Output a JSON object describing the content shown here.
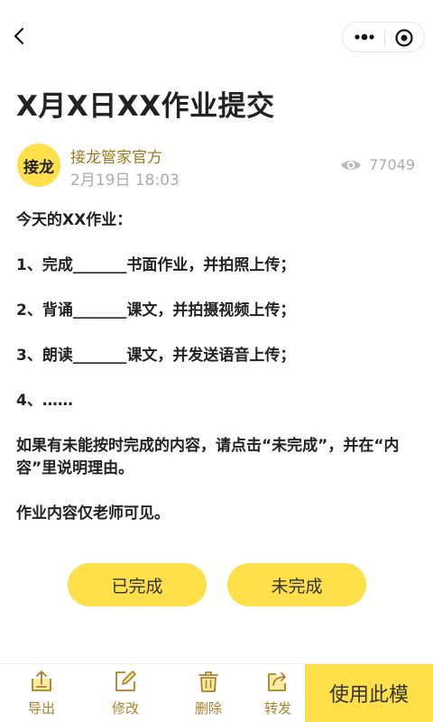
{
  "nav": {
    "back_icon": "chevron-left-icon",
    "menu_icon": "more-dots-icon",
    "close_icon": "target-icon"
  },
  "article": {
    "title": "X月X日XX作业提交",
    "author": {
      "avatar_text": "接龙",
      "name": "接龙管家官方",
      "date": "2月19日 18:03"
    },
    "views": "77049",
    "paragraphs": {
      "intro": "今天的XX作业：",
      "item1": "1、完成_______书面作业，并拍照上传；",
      "item2": "2、背诵_______课文，并拍摄视频上传；",
      "item3": "3、朗读_______课文，并发送语音上传；",
      "item4": "4、……",
      "note": "如果有未能按时完成的内容，请点击“未完成”，并在“内容”里说明理由。",
      "visibility": "作业内容仅老师可见。"
    }
  },
  "actions": {
    "done_label": "已完成",
    "undone_label": "未完成"
  },
  "toolbar": {
    "export_label": "导出",
    "edit_label": "修改",
    "delete_label": "删除",
    "share_label": "转发",
    "use_template_label": "使用此模"
  },
  "colors": {
    "accent": "#ffe04b",
    "label_gold": "#a9822a",
    "author_gold": "#9a7a1c",
    "muted": "#aaaaaa"
  }
}
